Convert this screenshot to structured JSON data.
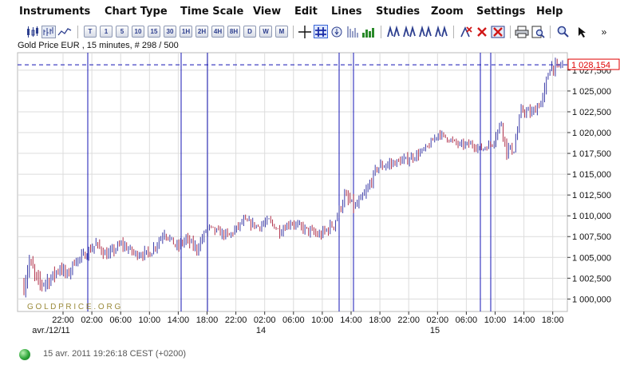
{
  "menu": {
    "items": [
      "Instruments",
      "Chart Type",
      "Time Scale",
      "View",
      "Edit",
      "Lines",
      "Studies",
      "Zoom",
      "Settings",
      "Help"
    ]
  },
  "toolbar": {
    "chart_type_icons": [
      "candlestick-chart-icon",
      "bar-chart-icon",
      "line-chart-icon"
    ],
    "time_scale_buttons": [
      "T",
      "1",
      "5",
      "10",
      "15",
      "30",
      "1H",
      "2H",
      "4H",
      "8H",
      "D",
      "W",
      "M"
    ],
    "view_icons": [
      "crosshair-icon",
      "grid-icon",
      "info-icon",
      "scale-icon",
      "volume-icon"
    ],
    "line_tool_icons": [
      "draw-line-icon",
      "draw-line-2-icon",
      "draw-line-3-icon",
      "draw-line-4-icon",
      "draw-line-5-icon"
    ],
    "edit_icons": [
      "delete-line-icon",
      "close-icon",
      "delete-all-icon"
    ],
    "file_icons": [
      "print-icon",
      "print-preview-icon"
    ],
    "zoom_icons": [
      "zoom-icon",
      "pointer-icon",
      "collapse-icon"
    ]
  },
  "chart_header": "Gold Price EUR , 15 minutes, # 298 / 500",
  "chart_data": {
    "type": "bar",
    "title": "Gold Price EUR , 15 minutes, # 298 / 500",
    "ylim": [
      998500,
      1029600
    ],
    "yticks": [
      1000000,
      1002500,
      1005000,
      1007500,
      1010000,
      1012500,
      1015000,
      1017500,
      1020000,
      1022500,
      1025000,
      1027500
    ],
    "ytick_labels": [
      "1 000,000",
      "1 002,500",
      "1 005,000",
      "1 007,500",
      "1 010,000",
      "1 012,500",
      "1 015,000",
      "1 017,500",
      "1 020,000",
      "1 022,500",
      "1 025,000",
      "1 027,500"
    ],
    "xtick_labels": [
      "22:00",
      "02:00",
      "06:00",
      "10:00",
      "14:00",
      "18:00",
      "22:00",
      "02:00",
      "06:00",
      "10:00",
      "14:00",
      "18:00",
      "22:00",
      "02:00",
      "06:00",
      "10:00",
      "14:00",
      "18:00"
    ],
    "date_labels": [
      "avr./12/11",
      "14",
      "15"
    ],
    "price_marker": {
      "value": 1028154,
      "label": "1 028,154"
    },
    "watermark": "G O L D P R I C E . O R G",
    "grid": true,
    "close_anchors": [
      [
        0,
        1001500
      ],
      [
        3,
        1004500
      ],
      [
        8,
        1001800
      ],
      [
        14,
        1002300
      ],
      [
        20,
        1003800
      ],
      [
        24,
        1002800
      ],
      [
        28,
        1004500
      ],
      [
        34,
        1005300
      ],
      [
        40,
        1006600
      ],
      [
        46,
        1005200
      ],
      [
        54,
        1006600
      ],
      [
        62,
        1005400
      ],
      [
        70,
        1005500
      ],
      [
        78,
        1008000
      ],
      [
        85,
        1006200
      ],
      [
        90,
        1007200
      ],
      [
        96,
        1006000
      ],
      [
        102,
        1008600
      ],
      [
        108,
        1008000
      ],
      [
        114,
        1007600
      ],
      [
        122,
        1009400
      ],
      [
        130,
        1008700
      ],
      [
        136,
        1009400
      ],
      [
        142,
        1008100
      ],
      [
        148,
        1009200
      ],
      [
        156,
        1008400
      ],
      [
        164,
        1007600
      ],
      [
        172,
        1009000
      ],
      [
        178,
        1012300
      ],
      [
        184,
        1011000
      ],
      [
        190,
        1012800
      ],
      [
        196,
        1015800
      ],
      [
        204,
        1016300
      ],
      [
        212,
        1016700
      ],
      [
        218,
        1017300
      ],
      [
        224,
        1018200
      ],
      [
        230,
        1019900
      ],
      [
        236,
        1019200
      ],
      [
        242,
        1018500
      ],
      [
        248,
        1018600
      ],
      [
        254,
        1018000
      ],
      [
        260,
        1018700
      ],
      [
        265,
        1021200
      ],
      [
        268,
        1017900
      ],
      [
        272,
        1018000
      ],
      [
        276,
        1022700
      ],
      [
        282,
        1022300
      ],
      [
        288,
        1024000
      ],
      [
        292,
        1028000
      ],
      [
        296,
        1027800
      ],
      [
        298,
        1028154
      ]
    ],
    "volatility_anchors": [
      [
        0,
        1600
      ],
      [
        10,
        1500
      ],
      [
        30,
        1000
      ],
      [
        60,
        900
      ],
      [
        90,
        1000
      ],
      [
        120,
        800
      ],
      [
        150,
        800
      ],
      [
        175,
        1200
      ],
      [
        200,
        1000
      ],
      [
        230,
        700
      ],
      [
        260,
        700
      ],
      [
        265,
        1400
      ],
      [
        270,
        1300
      ],
      [
        275,
        800
      ],
      [
        290,
        1300
      ],
      [
        298,
        1000
      ]
    ]
  },
  "status": {
    "datetime": "15 avr. 2011 19:26:18  CEST (+0200)"
  },
  "colors": {
    "bar_up": "#3d3da8",
    "bar_down": "#b0304a",
    "vline": "#1414b4",
    "marker": "#e00000",
    "grid": "#dcdcdc",
    "watermark": "#9a8a3a"
  }
}
